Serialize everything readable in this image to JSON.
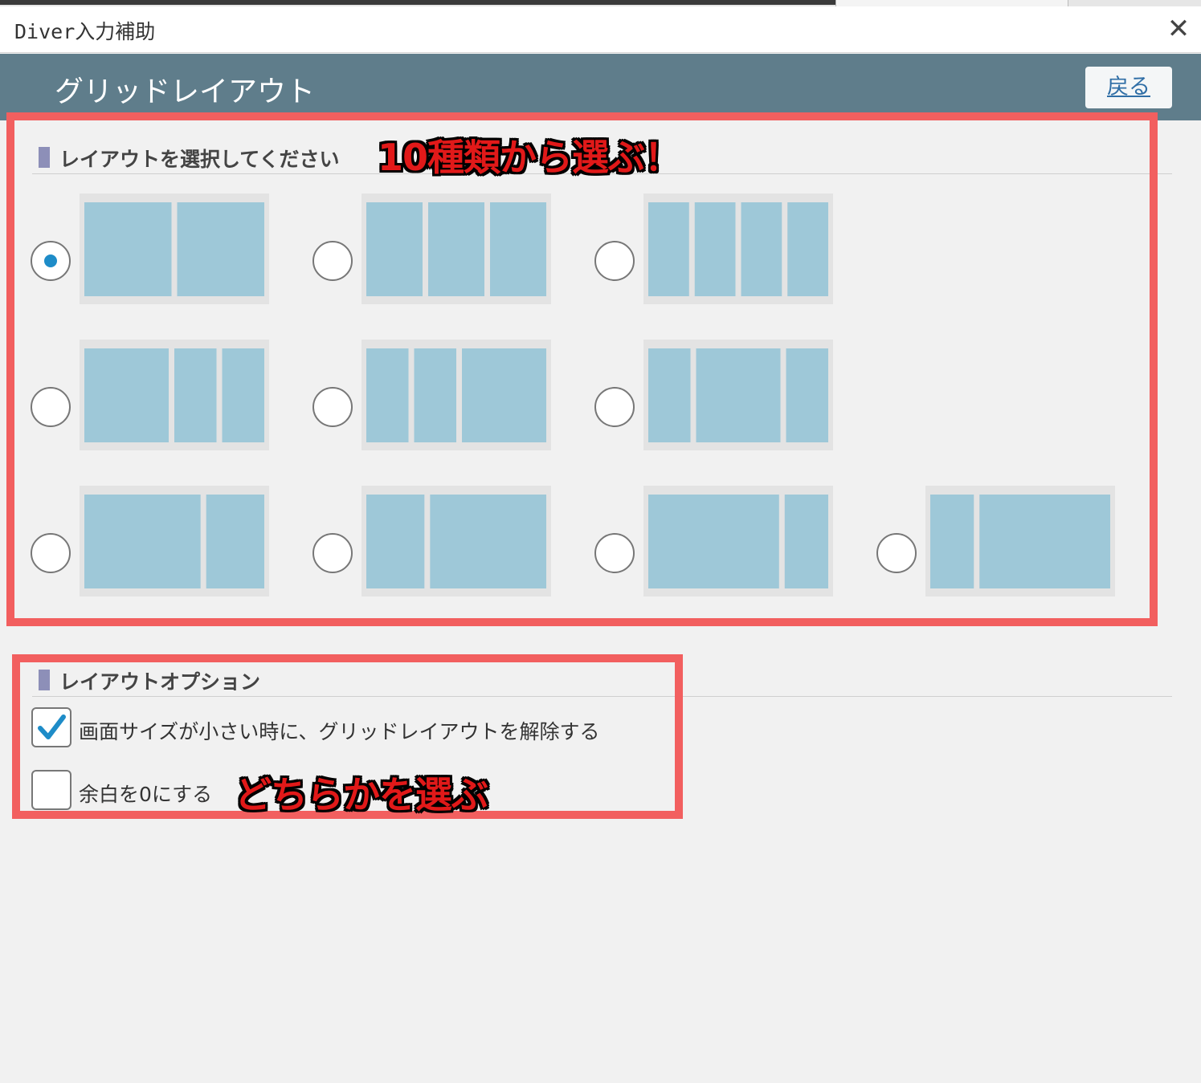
{
  "window": {
    "title": "Diver入力補助",
    "close_icon": "close-icon"
  },
  "header": {
    "title": "グリッドレイアウト",
    "back_label": "戻る"
  },
  "layout_section": {
    "title": "レイアウトを選択してください",
    "annotation": "10種類から選ぶ！",
    "selected_index": 0,
    "layouts": [
      {
        "name": "1:1",
        "columns": [
          1,
          1
        ]
      },
      {
        "name": "1:1:1",
        "columns": [
          1,
          1,
          1
        ]
      },
      {
        "name": "1:1:1:1",
        "columns": [
          1,
          1,
          1,
          1
        ]
      },
      {
        "name": "2:1:1",
        "columns": [
          2,
          1,
          1
        ]
      },
      {
        "name": "1:1:2",
        "columns": [
          1,
          1,
          2
        ]
      },
      {
        "name": "1:2:1",
        "columns": [
          1,
          2,
          1
        ]
      },
      {
        "name": "2:1",
        "columns": [
          2,
          1
        ]
      },
      {
        "name": "1:2",
        "columns": [
          1,
          2
        ]
      },
      {
        "name": "3:1",
        "columns": [
          3,
          1
        ]
      },
      {
        "name": "1:3",
        "columns": [
          1,
          3
        ]
      }
    ]
  },
  "options_section": {
    "title": "レイアウトオプション",
    "annotation": "どちらかを選ぶ",
    "options": [
      {
        "label": "画面サイズが小さい時に、グリッドレイアウトを解除する",
        "checked": true
      },
      {
        "label": "余白を0にする",
        "checked": false
      }
    ]
  },
  "colors": {
    "header_bg": "#5f7d8b",
    "accent": "#1e8cc8",
    "cell": "#9ec8d8",
    "annotation": "#f25f5f"
  }
}
